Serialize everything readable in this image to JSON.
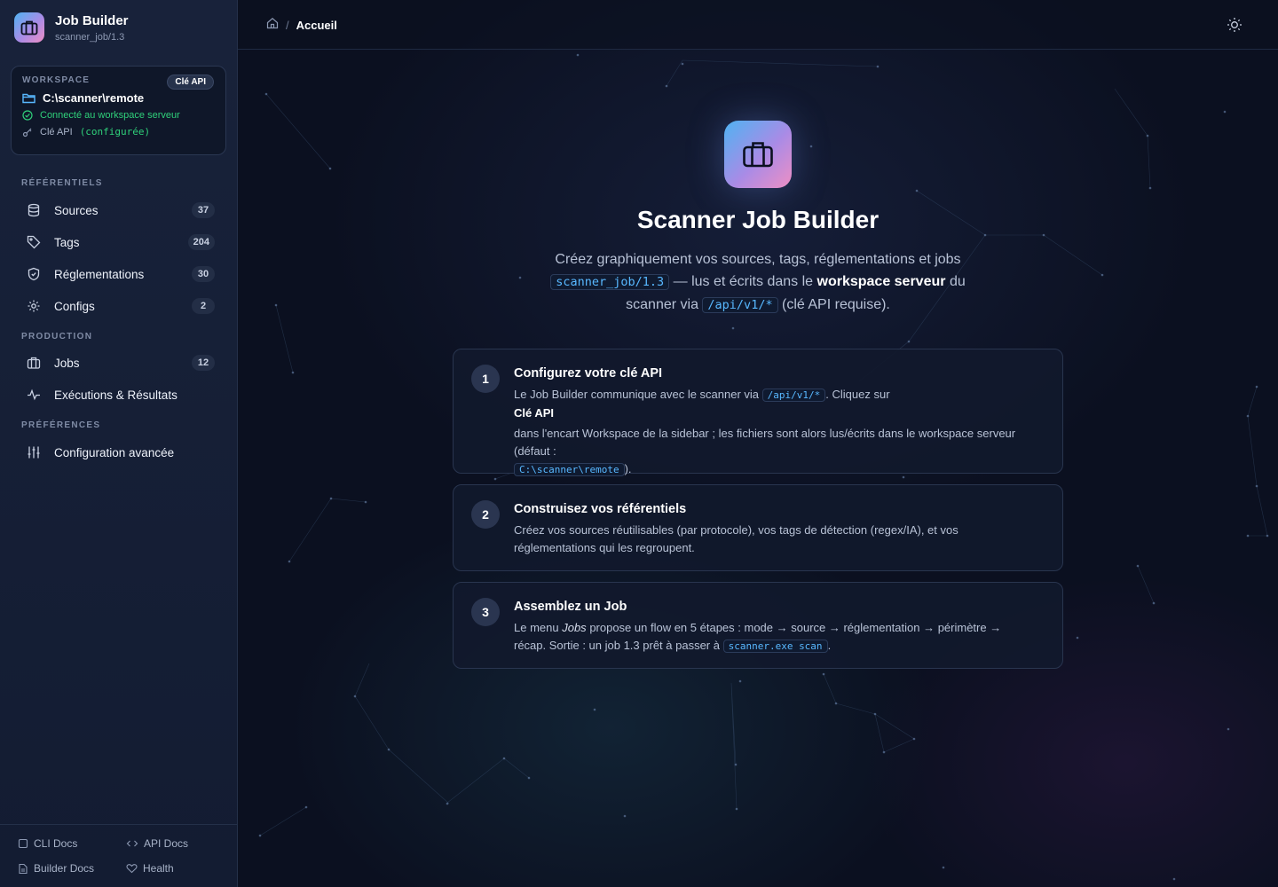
{
  "brand": {
    "title": "Job Builder",
    "subtitle": "scanner_job/1.3"
  },
  "workspace": {
    "label": "WORKSPACE",
    "api_badge": "Clé API",
    "path": "C:\\scanner\\remote",
    "status": "Connecté au workspace serveur",
    "key_label": "Clé API",
    "key_value": "(configurée)"
  },
  "nav": {
    "sections": {
      "referentiels": "RÉFÉRENTIELS",
      "production": "PRODUCTION",
      "preferences": "PRÉFÉRENCES"
    },
    "items": {
      "sources": {
        "label": "Sources",
        "count": "37"
      },
      "tags": {
        "label": "Tags",
        "count": "204"
      },
      "reglementations": {
        "label": "Réglementations",
        "count": "30"
      },
      "configs": {
        "label": "Configs",
        "count": "2"
      },
      "jobs": {
        "label": "Jobs",
        "count": "12"
      },
      "executions": {
        "label": "Exécutions & Résultats"
      },
      "advanced": {
        "label": "Configuration avancée"
      }
    }
  },
  "footer": {
    "cli_docs": "CLI Docs",
    "api_docs": "API Docs",
    "builder_docs": "Builder Docs",
    "health": "Health"
  },
  "topbar": {
    "separator": "/",
    "current": "Accueil"
  },
  "hero": {
    "title": "Scanner Job Builder",
    "desc_1": "Créez graphiquement vos sources, tags, réglementations et jobs",
    "desc_code_1": "scanner_job/1.3",
    "desc_2": "— lus et écrits dans le",
    "desc_bold": "workspace serveur",
    "desc_3": "du scanner via",
    "desc_code_2": "/api/v1/*",
    "desc_4": "(clé API requise)."
  },
  "steps": [
    {
      "number": "1",
      "title": "Configurez votre clé API",
      "text_1": "Le Job Builder communique avec le scanner via",
      "code_1": "/api/v1/*",
      "text_2": ". Cliquez sur",
      "bold": "Clé API",
      "text_3": "dans l'encart Workspace de la sidebar ; les fichiers sont alors lus/écrits dans le workspace serveur (défaut :",
      "code_2": "C:\\scanner\\remote",
      "text_4": ")."
    },
    {
      "number": "2",
      "title": "Construisez vos référentiels",
      "text_1": "Créez vos sources réutilisables (par protocole), vos tags de détection (regex/IA), et vos réglementations qui les regroupent."
    },
    {
      "number": "3",
      "title": "Assemblez un Job",
      "text_1": "Le menu",
      "italic": "Jobs",
      "text_2": "propose un flow en 5 étapes : mode → source → réglementation → périmètre → récap. Sortie : un job 1.3 prêt à passer à",
      "code_1": "scanner.exe scan",
      "text_3": "."
    }
  ],
  "colors": {
    "accent": "#58b8ff",
    "success": "#2fd07a",
    "background": "#0b1020",
    "sidebar": "#18223a"
  },
  "icons": {
    "brand": "briefcase-icon",
    "folder": "folder-icon",
    "status": "check-circle-icon",
    "key": "key-icon",
    "sources": "database-icon",
    "tags": "tag-icon",
    "reglementations": "shield-icon",
    "configs": "gear-icon",
    "jobs": "briefcase-icon",
    "executions": "activity-icon",
    "advanced": "sliders-icon",
    "home": "home-icon",
    "theme": "sun-icon"
  }
}
